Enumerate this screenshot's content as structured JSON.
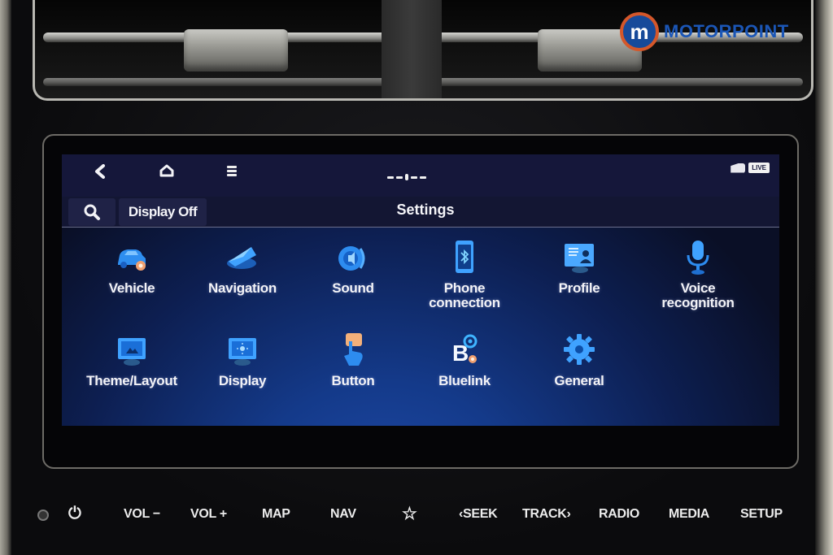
{
  "brand": {
    "badge_letter": "m",
    "name": "MOTORPOINT",
    "badge_color": "#174a9a",
    "ring_color": "#d4572a"
  },
  "status_bar": {
    "back_icon": "back-chevron-icon",
    "home_icon": "home-icon",
    "menu_icon": "menu-icon",
    "live_badge": "LIVE"
  },
  "header": {
    "search_icon": "⚲",
    "display_off_label": "Display Off",
    "title": "Settings"
  },
  "settings_items": [
    {
      "label": "Vehicle",
      "icon": "car-gear-icon"
    },
    {
      "label": "Navigation",
      "icon": "navigation-arrow-icon"
    },
    {
      "label": "Sound",
      "icon": "speaker-icon"
    },
    {
      "label": "Phone\nconnection",
      "icon": "phone-bluetooth-icon"
    },
    {
      "label": "Profile",
      "icon": "profile-card-icon"
    },
    {
      "label": "Voice\nrecognition",
      "icon": "microphone-icon"
    },
    {
      "label": "Theme/Layout",
      "icon": "theme-monitor-icon"
    },
    {
      "label": "Display",
      "icon": "brightness-monitor-icon"
    },
    {
      "label": "Button",
      "icon": "button-press-icon"
    },
    {
      "label": "Bluelink",
      "icon": "bluelink-icon"
    },
    {
      "label": "General",
      "icon": "gear-icon"
    }
  ],
  "hard_keys": [
    {
      "label": "⏻",
      "name": "power"
    },
    {
      "label": "VOL −",
      "name": "vol-down"
    },
    {
      "label": "VOL +",
      "name": "vol-up"
    },
    {
      "label": "MAP",
      "name": "map"
    },
    {
      "label": "NAV",
      "name": "nav"
    },
    {
      "label": "☆",
      "name": "favorite"
    },
    {
      "label": "‹SEEK",
      "name": "seek"
    },
    {
      "label": "TRACK›",
      "name": "track"
    },
    {
      "label": "RADIO",
      "name": "radio"
    },
    {
      "label": "MEDIA",
      "name": "media"
    },
    {
      "label": "SETUP",
      "name": "setup"
    }
  ]
}
